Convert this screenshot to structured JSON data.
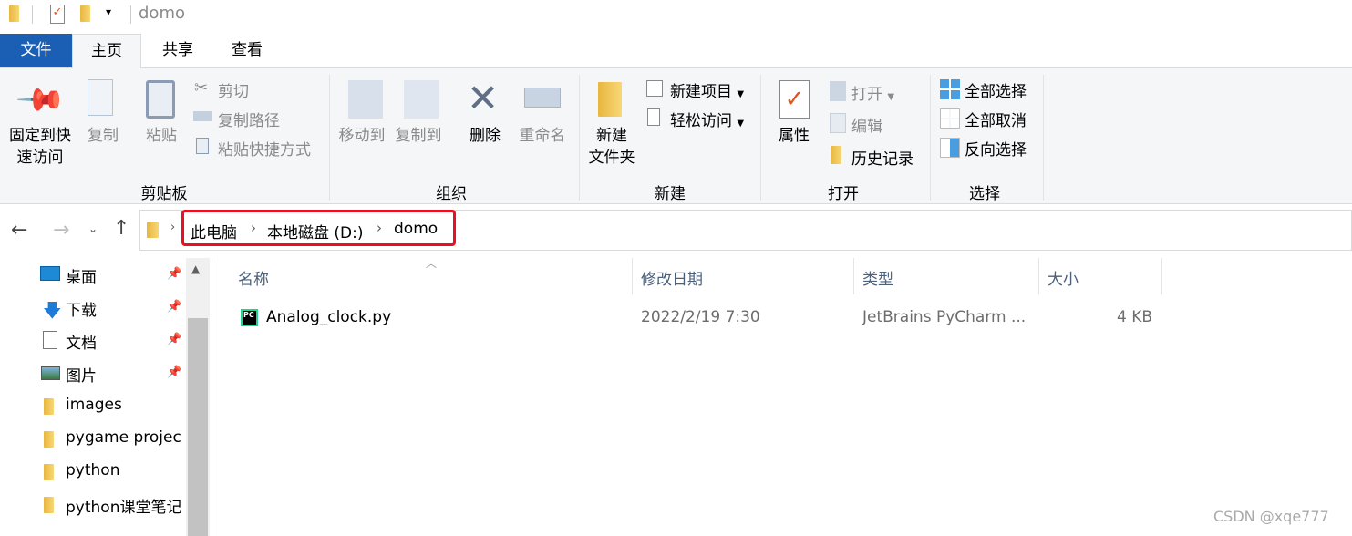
{
  "window": {
    "title": "domo"
  },
  "tabs": [
    {
      "label": "文件"
    },
    {
      "label": "主页"
    },
    {
      "label": "共享"
    },
    {
      "label": "查看"
    }
  ],
  "ribbon": {
    "clipboard": {
      "pin": "固定到快\n速访问",
      "pin1": "固定到快",
      "pin2": "速访问",
      "copy": "复制",
      "paste": "粘贴",
      "cut": "剪切",
      "copy_path": "复制路径",
      "paste_shortcut": "粘贴快捷方式",
      "group": "剪贴板"
    },
    "organize": {
      "move_to": "移动到",
      "copy_to": "复制到",
      "delete": "删除",
      "rename": "重命名",
      "group": "组织"
    },
    "new": {
      "new_folder1": "新建",
      "new_folder2": "文件夹",
      "new_item": "新建项目",
      "easy_access": "轻松访问",
      "group": "新建"
    },
    "open": {
      "properties": "属性",
      "open": "打开",
      "edit": "编辑",
      "history": "历史记录",
      "group": "打开"
    },
    "select": {
      "select_all": "全部选择",
      "select_none": "全部取消",
      "invert": "反向选择",
      "group": "选择"
    }
  },
  "address": {
    "crumbs": [
      "此电脑",
      "本地磁盘 (D:)",
      "domo"
    ],
    "highlight_color": "#e81123"
  },
  "sidebar": {
    "items": [
      {
        "label": "桌面",
        "pinned": true
      },
      {
        "label": "下载",
        "pinned": true
      },
      {
        "label": "文档",
        "pinned": true
      },
      {
        "label": "图片",
        "pinned": true
      },
      {
        "label": "images"
      },
      {
        "label": "pygame projec"
      },
      {
        "label": "python"
      },
      {
        "label": "python课堂笔记"
      }
    ]
  },
  "columns": {
    "name": "名称",
    "modified": "修改日期",
    "type": "类型",
    "size": "大小"
  },
  "files": [
    {
      "name": "Analog_clock.py",
      "modified": "2022/2/19 7:30",
      "type": "JetBrains PyCharm ...",
      "size": "4 KB"
    }
  ],
  "watermark": "CSDN @xqe777",
  "colors": {
    "file_tab": "#1a5fb4",
    "accent": "#0063b1"
  }
}
